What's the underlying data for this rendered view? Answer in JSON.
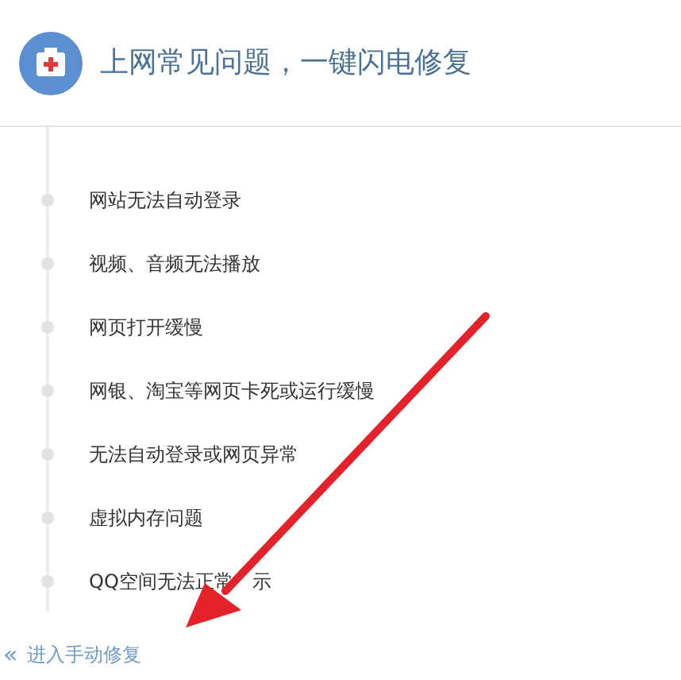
{
  "header": {
    "title": "上网常见问题，一键闪电修复"
  },
  "issues": [
    {
      "label": "网站无法自动登录"
    },
    {
      "label": "视频、音频无法播放"
    },
    {
      "label": "网页打开缓慢"
    },
    {
      "label": "网银、淘宝等网页卡死或运行缓慢"
    },
    {
      "label": "无法自动登录或网页异常"
    },
    {
      "label": "虚拟内存问题"
    },
    {
      "label": "QQ空间无法正常",
      "label_after_arrow": "示"
    }
  ],
  "footer_link": {
    "icon": "«",
    "label": "进入手动修复"
  }
}
